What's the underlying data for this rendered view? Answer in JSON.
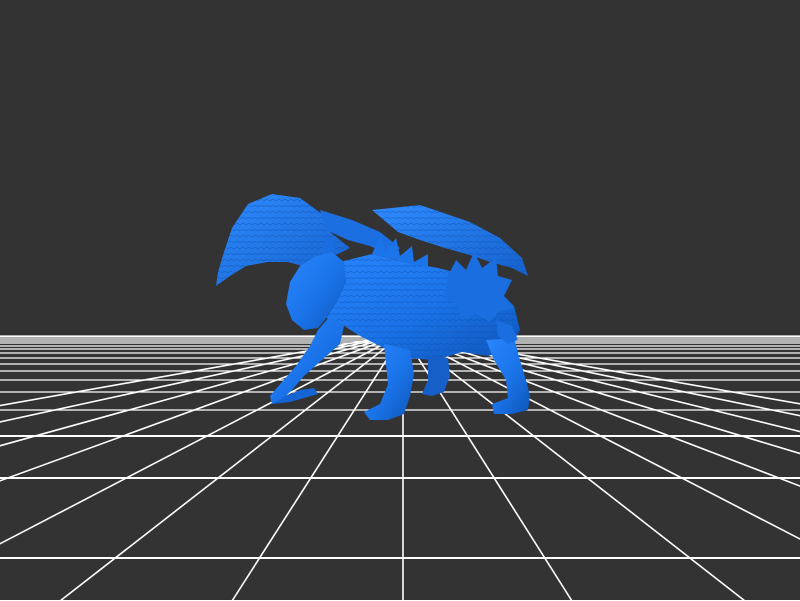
{
  "scene": {
    "background_color": "#333333",
    "grid_color": "#ffffff",
    "model_color": "#1a73e8",
    "model_subject": "dragon",
    "ground_grid": "on"
  }
}
